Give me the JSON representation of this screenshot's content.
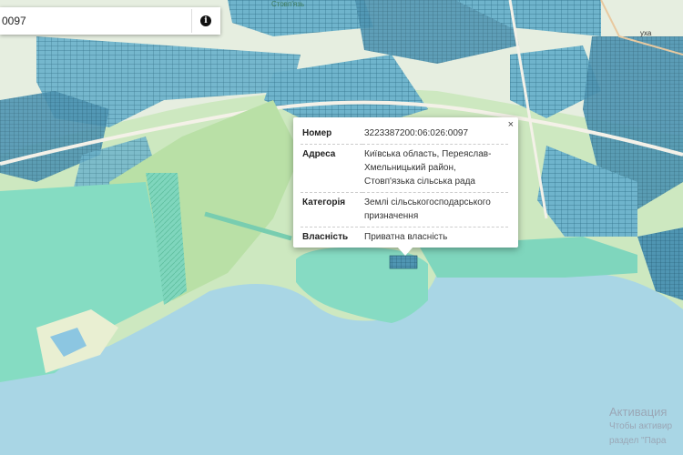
{
  "search": {
    "value": "0097"
  },
  "map_labels": {
    "top_center": "Стовп'язь",
    "top_right": "уха"
  },
  "popup": {
    "close_glyph": "×",
    "rows": [
      {
        "key": "Номер",
        "value": "3223387200:06:026:0097"
      },
      {
        "key": "Адреса",
        "value": "Київська область, Переяслав-Хмельницький район, Стовп'язька сільська рада"
      },
      {
        "key": "Категорія",
        "value": "Землі сільськогосподарського призначення"
      },
      {
        "key": "Власність",
        "value": "Приватна власність"
      }
    ]
  },
  "watermark": {
    "line1": "Активация",
    "line2": "Чтобы активир",
    "line3": "раздел \"Пара"
  },
  "icons": {
    "info": "info-icon",
    "close": "close-icon"
  },
  "colors": {
    "water": "#a9d6e5",
    "land": "#cfe9c4",
    "parcel_blue": "#5fa6c0",
    "parcel_teal": "#7fd4bd",
    "road": "#f0eee6"
  }
}
